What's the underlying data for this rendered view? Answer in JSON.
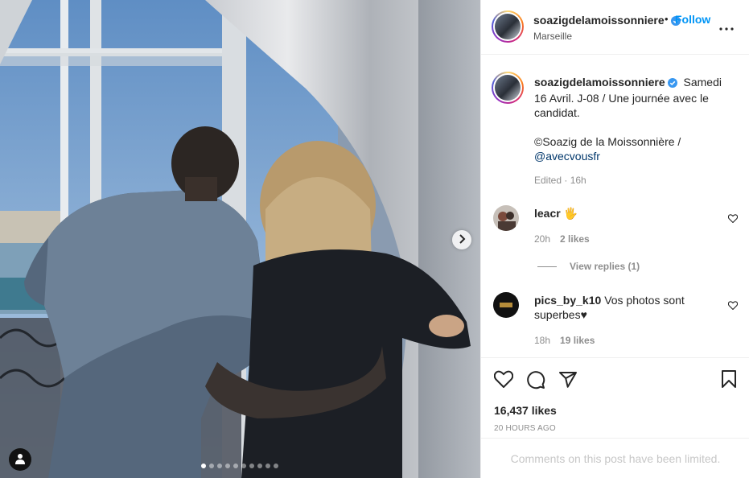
{
  "post": {
    "image_alt": "Photo by soazigdelamoissonniere",
    "carousel": {
      "count": 10,
      "active_index": 0
    }
  },
  "header": {
    "username": "soazigdelamoissonniere",
    "bullet": "•",
    "follow_label": "Follow",
    "location": "Marseille"
  },
  "caption": {
    "username": "soazigdelamoissonniere",
    "line1": "Samedi 16 Avril. J-08 / Une journée avec le candidat.",
    "line2": "©Soazig de la Moissonnière /",
    "mention": "@avecvousfr",
    "meta": "Edited · 16h"
  },
  "comments": [
    {
      "username": "leacr",
      "text": "🖐",
      "time": "20h",
      "likes": "2 likes",
      "view_replies": "View replies (1)"
    },
    {
      "username": "pics_by_k10",
      "text": "Vos photos sont superbes♥",
      "time": "18h",
      "likes": "19 likes"
    }
  ],
  "stats": {
    "likes": "16,437 likes",
    "time_ago": "20 HOURS AGO"
  },
  "footer": {
    "limited": "Comments on this post have been limited."
  },
  "colors": {
    "accent": "#0095f6",
    "verified": "#3897f0",
    "muted": "#8e8e8e",
    "mention": "#00376b"
  },
  "icons": [
    "verified-badge-icon",
    "more-options-icon",
    "heart-icon",
    "comment-icon",
    "share-icon",
    "bookmark-icon",
    "chevron-right-icon",
    "user-tag-icon"
  ]
}
